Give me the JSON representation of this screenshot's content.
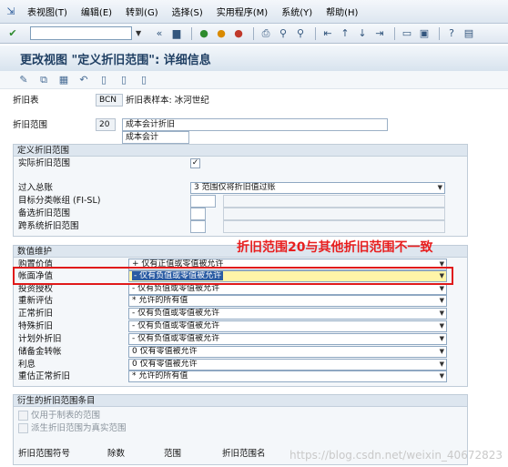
{
  "menubar": {
    "items": [
      {
        "label": "表视图(T)"
      },
      {
        "label": "编辑(E)"
      },
      {
        "label": "转到(G)"
      },
      {
        "label": "选择(S)"
      },
      {
        "label": "实用程序(M)"
      },
      {
        "label": "系统(Y)"
      },
      {
        "label": "帮助(H)"
      }
    ]
  },
  "page_title": "更改视图 \"定义折旧范围\": 详细信息",
  "header": {
    "depr_chart_label": "折旧表",
    "depr_chart_code": "BCN",
    "depr_chart_desc": "折旧表样本: 冰河世纪",
    "depr_area_label": "折旧范围",
    "depr_area_code": "20",
    "depr_area_long": "成本会计折旧",
    "depr_area_short": "成本会计"
  },
  "define_group": {
    "title": "定义折旧范围",
    "real_area_label": "实际折旧范围",
    "real_area_checked": "✓",
    "post_gl_label": "过入总账",
    "post_gl_value": "3 范围仅将折旧值过账",
    "target_ledger_label": "目标分类帐组 (FI-SL)",
    "alt_area_label": "备选折旧范围",
    "cross_sys_label": "跨系统折旧范围"
  },
  "value_group": {
    "title": "数值维护",
    "rows": [
      {
        "label": "购置价值",
        "value": "+ 仅有正值或零值被允许"
      },
      {
        "label": "帐面净值",
        "value": "- 仅有负值或零值被允许"
      },
      {
        "label": "投资授权",
        "value": "- 仅有负值或零值被允许"
      },
      {
        "label": "重新评估",
        "value": "* 允许的所有值"
      },
      {
        "label": "正常折旧",
        "value": "- 仅有负值或零值被允许"
      },
      {
        "label": "特殊折旧",
        "value": "- 仅有负值或零值被允许"
      },
      {
        "label": "计划外折旧",
        "value": "- 仅有负值或零值被允许"
      },
      {
        "label": "储备金转帐",
        "value": "0 仅有零值被允许"
      },
      {
        "label": "利息",
        "value": "0 仅有零值被允许"
      },
      {
        "label": "重估正常折旧",
        "value": "* 允许的所有值"
      }
    ]
  },
  "annotation": "折旧范围20与其他折旧范围不一致",
  "derived_group": {
    "title": "衍生的折旧范围条目",
    "opt1": "仅用于制表的范围",
    "opt2": "派生折旧范围为真实范围",
    "columns": [
      "折旧范围符号",
      "除数",
      "范围",
      "折旧范围名"
    ]
  },
  "watermark": "https://blog.csdn.net/weixin_40672823"
}
